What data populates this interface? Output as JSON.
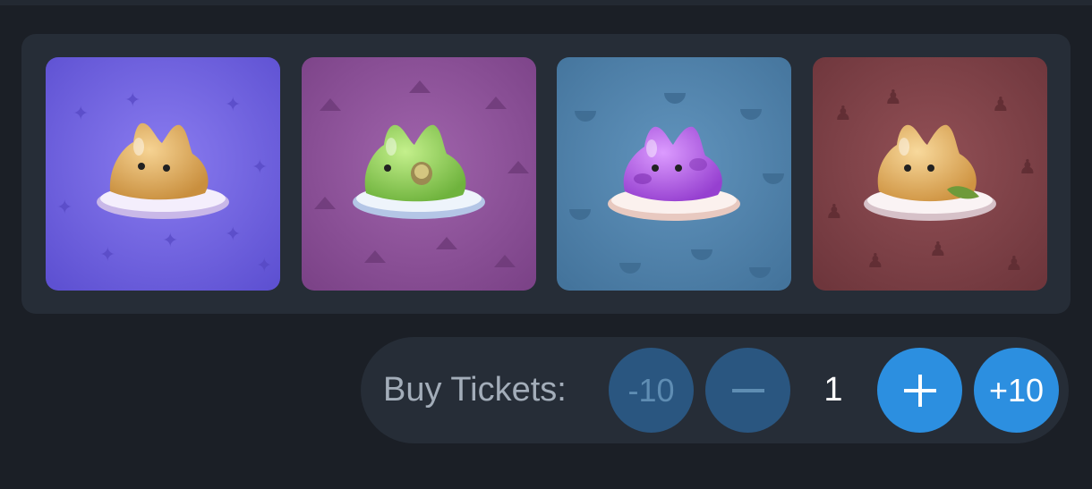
{
  "colors": {
    "background": "#1b1f26",
    "panel": "#262d37",
    "accent": "#2c8fe0",
    "accent_dim": "#2a5680"
  },
  "gallery": {
    "cards": [
      {
        "name": "sparkle-jelly",
        "background": "#6e60dc",
        "jelly": "#e0b067",
        "icon": "jelly-cat-icon"
      },
      {
        "name": "cheese-jelly",
        "background": "#8c4f98",
        "jelly": "#8fcf55",
        "icon": "jelly-cat-icon"
      },
      {
        "name": "watermelon-jelly",
        "background": "#4c7fa8",
        "jelly": "#b05fe0",
        "icon": "jelly-cat-icon"
      },
      {
        "name": "gingerbread-jelly",
        "background": "#7b3f44",
        "jelly": "#e3b66c",
        "icon": "jelly-cat-icon"
      }
    ]
  },
  "tickets": {
    "label": "Buy Tickets:",
    "minus_ten": "-10",
    "minus_icon": "minus-icon",
    "quantity": "1",
    "plus_icon": "plus-icon",
    "plus_ten": "+10"
  }
}
